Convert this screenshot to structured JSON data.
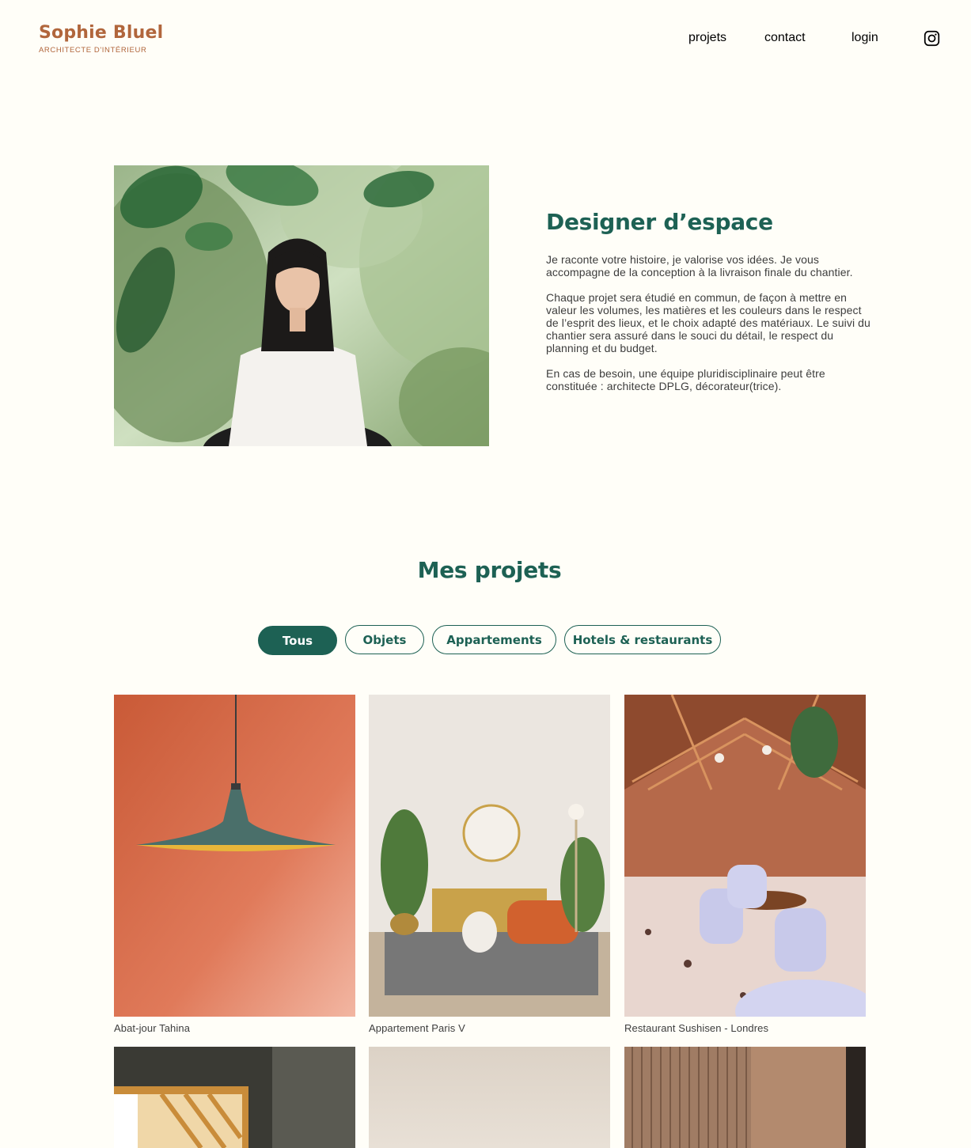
{
  "header": {
    "logo_title": "Sophie Bluel",
    "logo_subtitle": "ARCHITECTE D'INTÉRIEUR",
    "nav": {
      "projets": "projets",
      "contact": "contact",
      "login": "login"
    },
    "instagram_icon": "instagram-icon"
  },
  "intro": {
    "title": "Designer d’espace",
    "paragraphs": [
      "Je raconte votre histoire, je valorise vos idées. Je vous accompagne de la conception à la livraison finale du chantier.",
      "Chaque projet sera étudié en commun, de façon à mettre en valeur les volumes, les matières et les couleurs dans le respect de l’esprit des lieux, et le choix adapté des matériaux. Le suivi du chantier sera assuré dans le souci du détail, le respect du planning et du budget.",
      "En cas de besoin, une équipe pluridisciplinaire peut être constituée : architecte DPLG, décorateur(trice)."
    ]
  },
  "projects": {
    "title": "Mes projets",
    "filters": [
      "Tous",
      "Objets",
      "Appartements",
      "Hotels & restaurants"
    ],
    "active_filter": "Tous",
    "items": [
      {
        "caption": "Abat-jour Tahina"
      },
      {
        "caption": "Appartement Paris V"
      },
      {
        "caption": "Restaurant Sushisen - Londres"
      },
      {
        "caption": ""
      },
      {
        "caption": ""
      },
      {
        "caption": ""
      }
    ]
  },
  "colors": {
    "background": "#FFFEF8",
    "brand": "#B1663C",
    "accent": "#1D6154",
    "text": "#3D3D3D"
  }
}
